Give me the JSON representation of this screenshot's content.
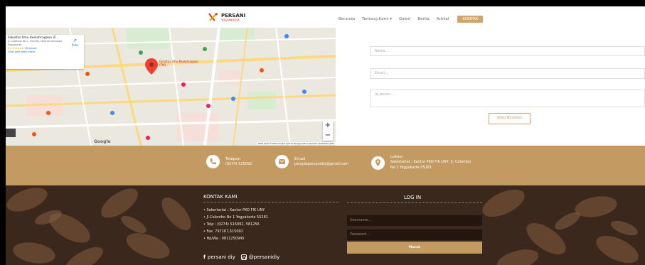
{
  "header": {
    "logo_name": "PERSANI",
    "logo_sub": "YOGYAKARTA",
    "nav": [
      {
        "label": "Beranda"
      },
      {
        "label": "Tentang Kami ▾"
      },
      {
        "label": "Galeri"
      },
      {
        "label": "Berita"
      },
      {
        "label": "Artikel"
      },
      {
        "label": "KONTAK"
      }
    ]
  },
  "map": {
    "place_title": "Fakultas Ilmu Keolahragaan (F...",
    "place_address": "Jl. Colombo No.1, Sleman, Daerah Istimewa Yogyakarta",
    "rating": "4.6 ★★★★★",
    "reviews": "38 ulasan",
    "larger_map": "Lihat peta lebih besar",
    "directions": "Rute",
    "footer_text": "Data peta ©2022 Google  Syarat Penggunaan  Laporkan kesalahan peta",
    "google": "Google",
    "zoom_in": "+",
    "zoom_out": "−",
    "pin_label": "Fakultas Ilmu Keolahragaan (FIK)..."
  },
  "form": {
    "name_placeholder": "Nama...",
    "email_placeholder": "Email...",
    "message_placeholder": "Isi pesan...",
    "send_label": "SEND MESSAGE"
  },
  "contact_bar": {
    "phone_label": "Telepon",
    "phone_value": "(0274) 515092",
    "email_label": "Email",
    "email_value": "pengdapersanidiy@gmail.com",
    "location_label": "Lokasi",
    "location_value_1": "Sekertariat : Kantor PKO FIK UNY, Jl. Colombo",
    "location_value_2": "No 1 Yogyakarta 55281"
  },
  "footer": {
    "kontak_title": "KONTAK KAMI",
    "kontak_items": [
      "• Sekertariat : Kantor PKO FIK UNY",
      "• Jl.Colombo No 1 Yogyakarta 55281",
      "• Telp : (0274) 515092, 581256",
      "• Fax. 797167,515092",
      "• Hp/Wa : 0811250945"
    ],
    "facebook": "persani diy",
    "instagram": "@persanidiy",
    "login_title": "LOG IN",
    "username_placeholder": "Username...",
    "password_placeholder": "Password...",
    "login_button": "Masuk"
  },
  "colors": {
    "accent": "#c49a63",
    "footer_bg": "#3b2a1f"
  }
}
